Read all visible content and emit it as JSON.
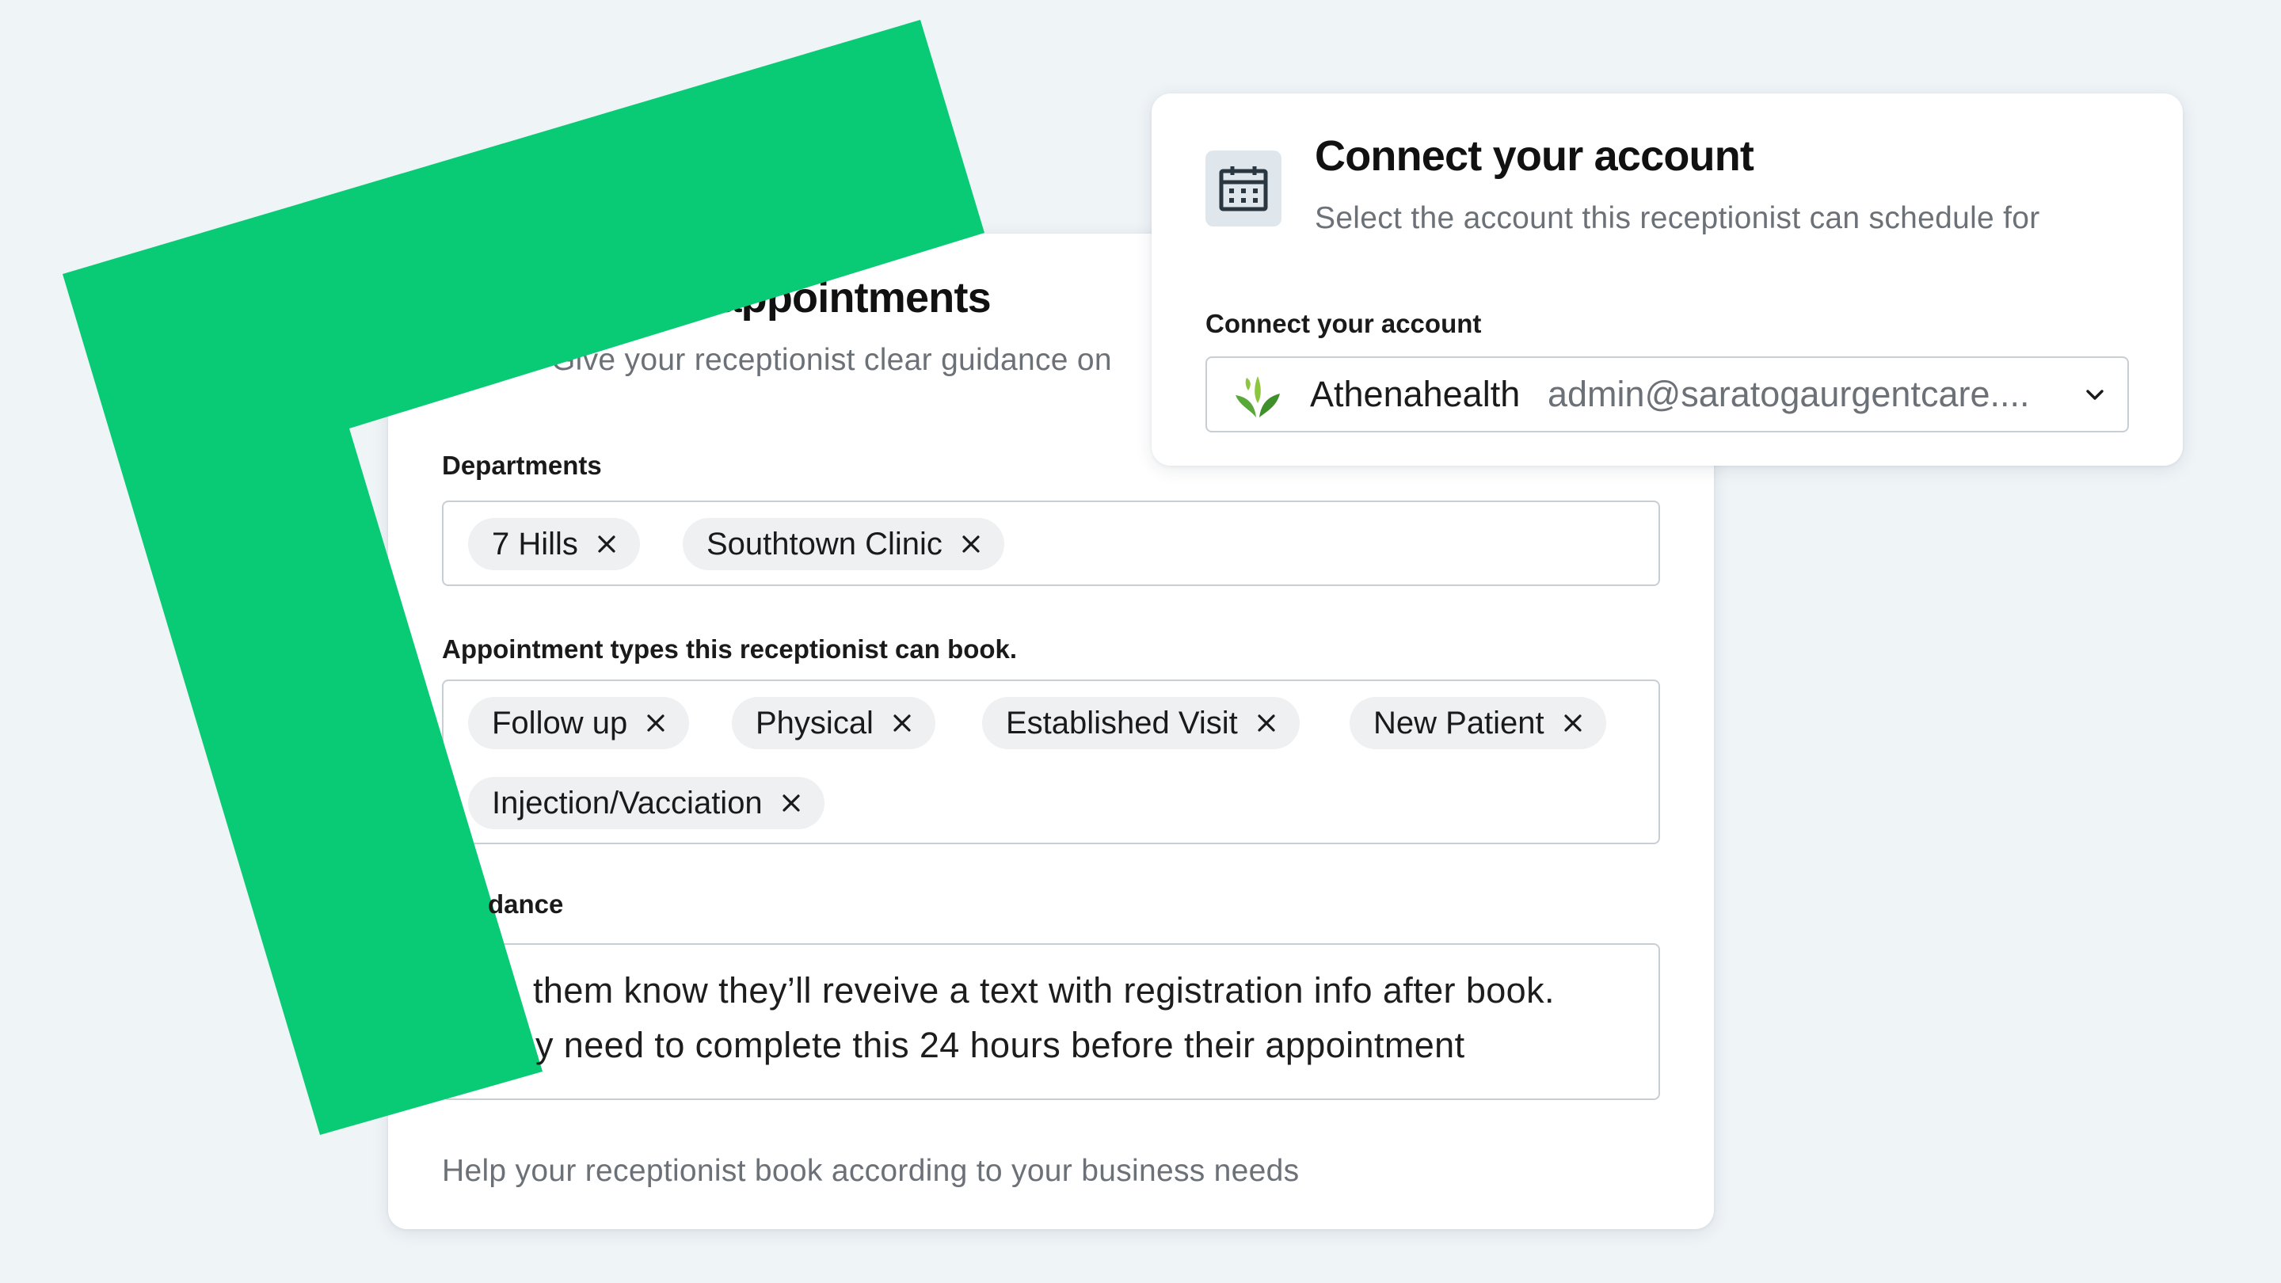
{
  "manage": {
    "title": "Manage appointments",
    "subtitle": "Give your receptionist clear guidance on",
    "departments_label": "Departments",
    "departments": [
      "7 Hills",
      "Southtown Clinic"
    ],
    "types_label": "Appointment types this receptionist can book.",
    "types": [
      "Follow up",
      "Physical",
      "Established Visit",
      "New Patient",
      "Injection/Vacciation"
    ],
    "guidance_label_visible": "dance",
    "guidance_lines_visible": [
      "them know they’ll reveive a text with registration info after book.",
      "y need to complete this 24 hours before their appointment"
    ],
    "help_text": "Help your receptionist book according to your business needs",
    "icon": "calendar-icon",
    "remove_icon": "close-icon"
  },
  "connect": {
    "title": "Connect your account",
    "subtitle": "Select the account this receptionist can schedule for",
    "field_label": "Connect your account",
    "selected_provider": "Athenahealth",
    "selected_email": "admin@saratogaurgentcare....",
    "provider_icon": "athenahealth-leaf-icon",
    "dropdown_icon": "chevron-down-icon",
    "icon": "calendar-icon"
  },
  "colors": {
    "background": "#eff4f7",
    "accent_green": "#09cb75",
    "card": "#ffffff",
    "chip": "#eef0f2",
    "muted_text": "#6b7177",
    "border": "#c9ced3"
  }
}
